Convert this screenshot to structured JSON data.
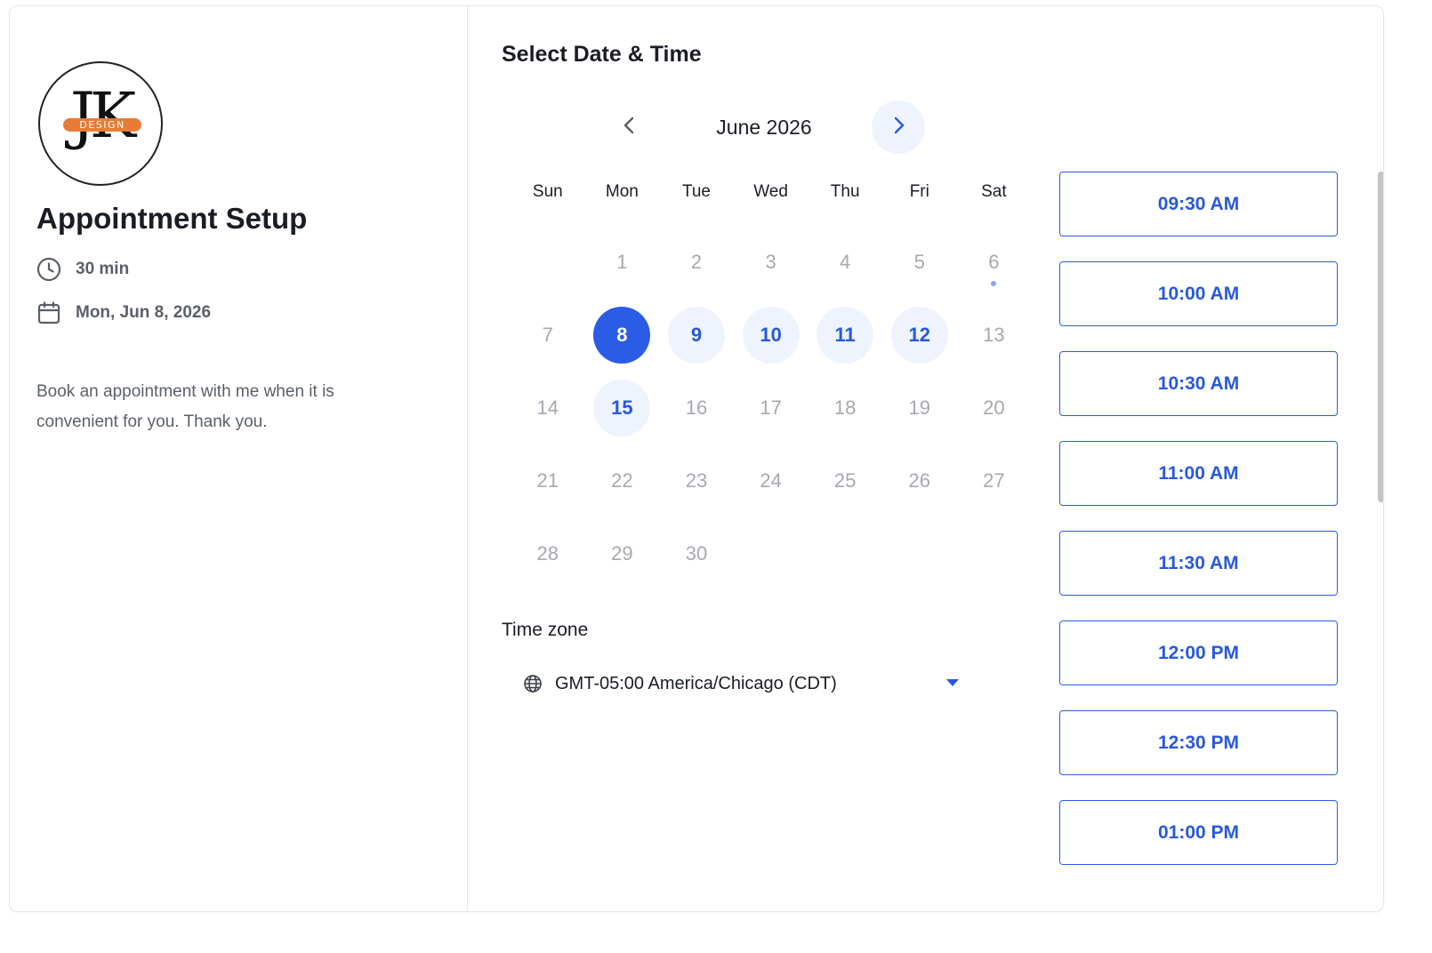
{
  "event": {
    "logo": {
      "letters": "JK",
      "band_text": "DESIGN",
      "band_color": "#e87c35"
    },
    "title": "Appointment Setup",
    "duration": "30 min",
    "date": "Mon, Jun 8, 2026",
    "description": "Book an appointment with me when it is convenient for you. Thank you."
  },
  "scheduler": {
    "heading": "Select Date & Time",
    "month_label": "June 2026",
    "weekdays": [
      "Sun",
      "Mon",
      "Tue",
      "Wed",
      "Thu",
      "Fri",
      "Sat"
    ],
    "days": [
      {
        "d": ""
      },
      {
        "d": "1"
      },
      {
        "d": "2"
      },
      {
        "d": "3"
      },
      {
        "d": "4"
      },
      {
        "d": "5"
      },
      {
        "d": "6",
        "today": true
      },
      {
        "d": "7"
      },
      {
        "d": "8",
        "state": "selected"
      },
      {
        "d": "9",
        "state": "available"
      },
      {
        "d": "10",
        "state": "available"
      },
      {
        "d": "11",
        "state": "available"
      },
      {
        "d": "12",
        "state": "available"
      },
      {
        "d": "13"
      },
      {
        "d": "14"
      },
      {
        "d": "15",
        "state": "available"
      },
      {
        "d": "16"
      },
      {
        "d": "17"
      },
      {
        "d": "18"
      },
      {
        "d": "19"
      },
      {
        "d": "20"
      },
      {
        "d": "21"
      },
      {
        "d": "22"
      },
      {
        "d": "23"
      },
      {
        "d": "24"
      },
      {
        "d": "25"
      },
      {
        "d": "26"
      },
      {
        "d": "27"
      },
      {
        "d": "28"
      },
      {
        "d": "29"
      },
      {
        "d": "30"
      }
    ],
    "timezone_label": "Time zone",
    "timezone_value": "GMT-05:00 America/Chicago (CDT)",
    "time_slots": [
      "09:30 AM",
      "10:00 AM",
      "10:30 AM",
      "11:00 AM",
      "11:30 AM",
      "12:00 PM",
      "12:30 PM",
      "01:00 PM"
    ]
  },
  "colors": {
    "accent": "#2b5ce6",
    "accent_text": "#2859db",
    "available_bg": "#eef3fd",
    "muted_text": "#a6a9b0"
  },
  "icons": {
    "duration": "clock-icon",
    "date": "calendar-icon",
    "timezone": "globe-icon",
    "prev": "chevron-left-icon",
    "next": "chevron-right-icon",
    "dropdown": "caret-down-icon"
  }
}
